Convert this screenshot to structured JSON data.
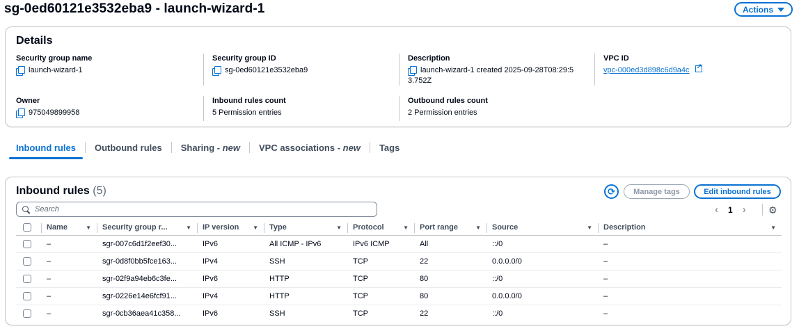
{
  "header": {
    "title": "sg-0ed60121e3532eba9 - launch-wizard-1",
    "actions_label": "Actions"
  },
  "details": {
    "title": "Details",
    "security_group_name": {
      "label": "Security group name",
      "value": "launch-wizard-1"
    },
    "security_group_id": {
      "label": "Security group ID",
      "value": "sg-0ed60121e3532eba9"
    },
    "description": {
      "label": "Description",
      "value_line1": "launch-wizard-1 created 2025-09-28T08:29:5",
      "value_line2": "3.752Z"
    },
    "vpc_id": {
      "label": "VPC ID",
      "value": "vpc-000ed3d898c6d9a4c"
    },
    "owner": {
      "label": "Owner",
      "value": "975049899958"
    },
    "inbound_rules_count": {
      "label": "Inbound rules count",
      "value": "5 Permission entries"
    },
    "outbound_rules_count": {
      "label": "Outbound rules count",
      "value": "2 Permission entries"
    }
  },
  "tabs": [
    {
      "label": "Inbound rules",
      "suffix": ""
    },
    {
      "label": "Outbound rules",
      "suffix": ""
    },
    {
      "label": "Sharing - ",
      "suffix": "new"
    },
    {
      "label": "VPC associations - ",
      "suffix": "new"
    },
    {
      "label": "Tags",
      "suffix": ""
    }
  ],
  "inbound": {
    "title": "Inbound rules",
    "count": "(5)",
    "refresh_icon": "refresh-icon",
    "manage_tags_label": "Manage tags",
    "edit_label": "Edit inbound rules",
    "search_placeholder": "Search",
    "page": "1",
    "columns": [
      "Name",
      "Security group r...",
      "IP version",
      "Type",
      "Protocol",
      "Port range",
      "Source",
      "Description"
    ],
    "rows": [
      [
        "–",
        "sgr-007c6d1f2eef30...",
        "IPv6",
        "All ICMP - IPv6",
        "IPv6 ICMP",
        "All",
        "::/0",
        "–"
      ],
      [
        "–",
        "sgr-0d8f0bb5fce163...",
        "IPv4",
        "SSH",
        "TCP",
        "22",
        "0.0.0.0/0",
        "–"
      ],
      [
        "–",
        "sgr-02f9a94eb6c3fe...",
        "IPv6",
        "HTTP",
        "TCP",
        "80",
        "::/0",
        "–"
      ],
      [
        "–",
        "sgr-0226e14e6fcf91...",
        "IPv4",
        "HTTP",
        "TCP",
        "80",
        "0.0.0.0/0",
        "–"
      ],
      [
        "–",
        "sgr-0cb36aea41c358...",
        "IPv6",
        "SSH",
        "TCP",
        "22",
        "::/0",
        "–"
      ]
    ]
  },
  "colors": {
    "accent": "#0972d3",
    "text": "#000716",
    "border": "#c6c6cd"
  }
}
